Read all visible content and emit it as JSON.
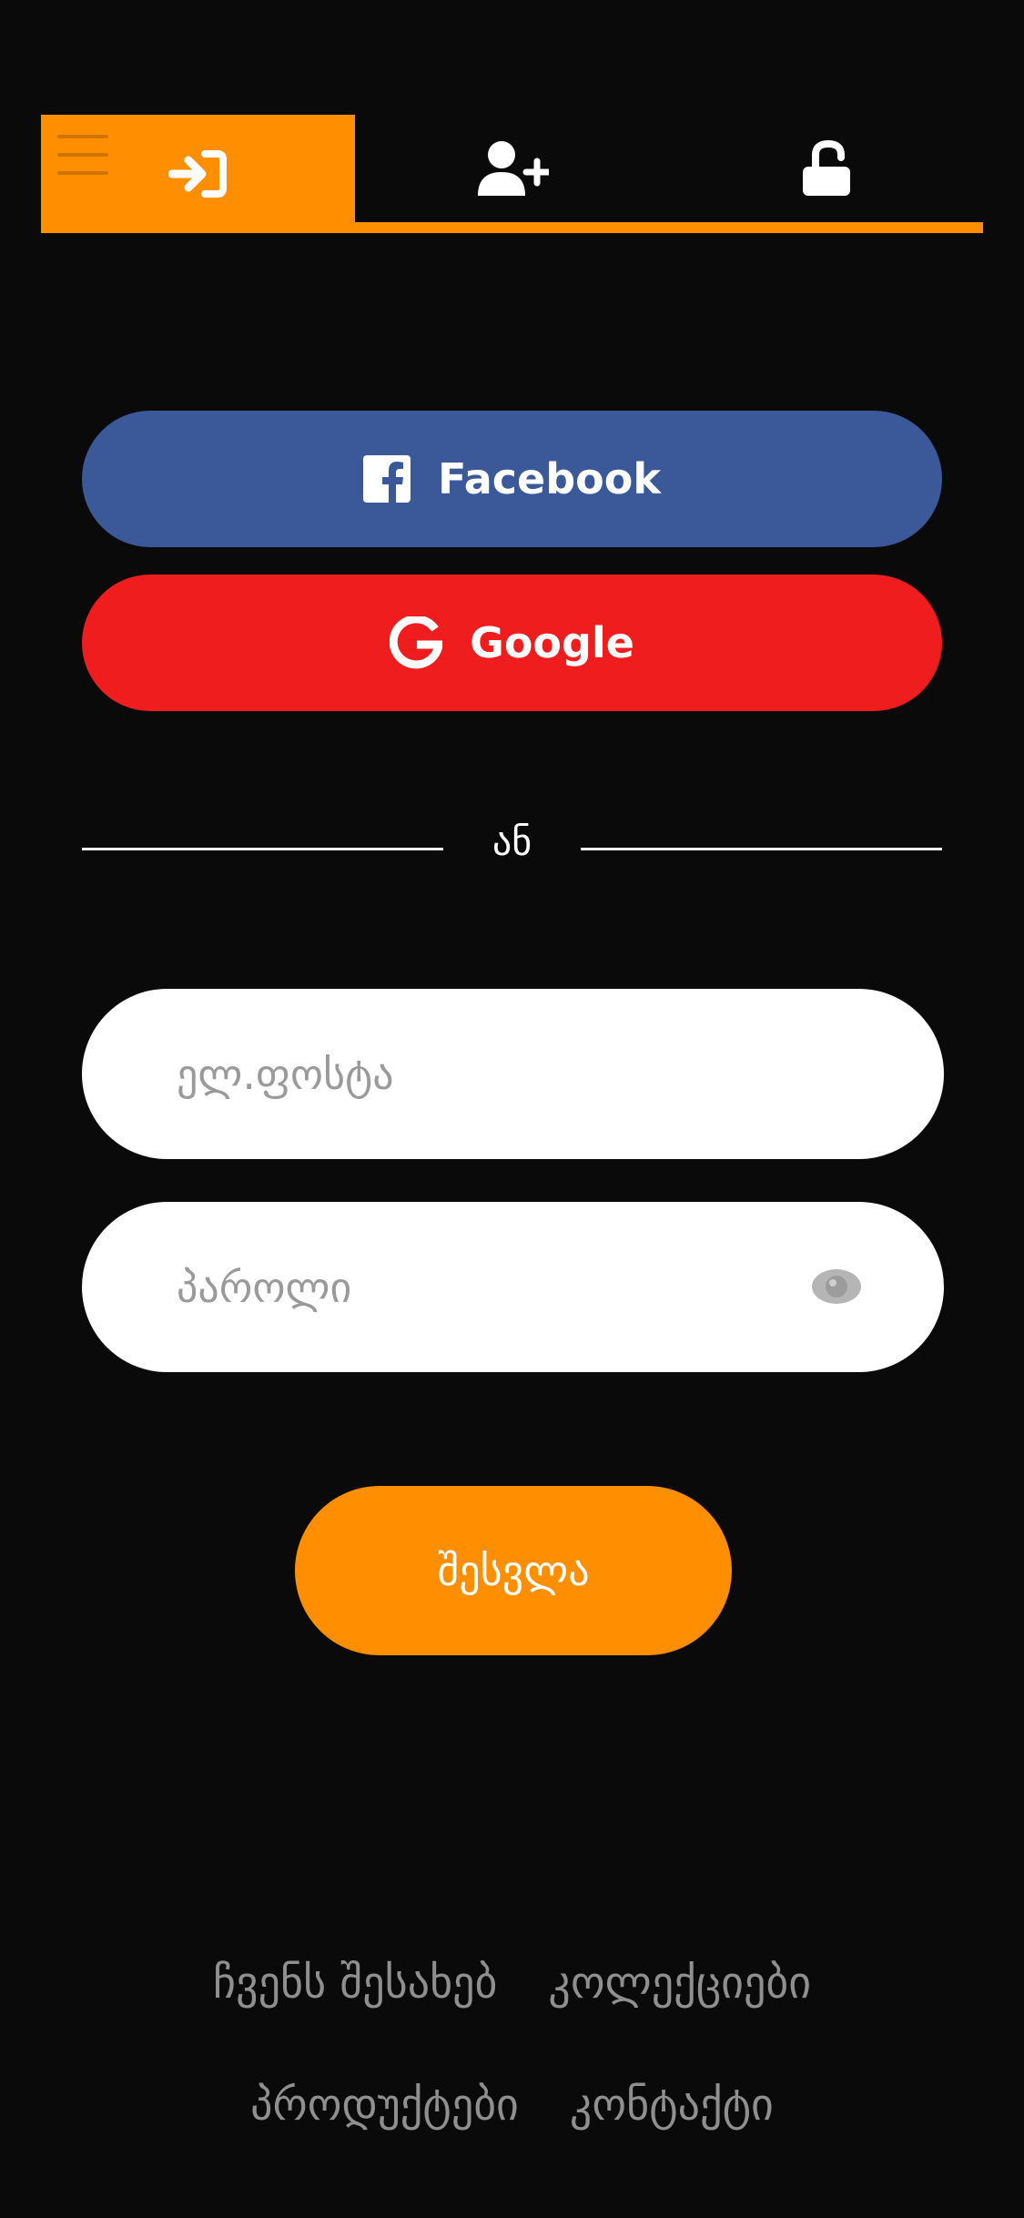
{
  "tabs": [
    {
      "id": "login",
      "icon": "sign-in-icon",
      "active": true
    },
    {
      "id": "register",
      "icon": "user-plus-icon",
      "active": false
    },
    {
      "id": "reset",
      "icon": "unlock-icon",
      "active": false
    }
  ],
  "menu": {
    "icon": "hamburger-menu-icon"
  },
  "social": {
    "facebook_label": "Facebook",
    "google_label": "Google"
  },
  "divider": {
    "text": "ან"
  },
  "form": {
    "email_placeholder": "ელ.ფოსტა",
    "password_placeholder": "პაროლი",
    "eye_icon": "eye-icon",
    "submit_label": "შესვლა"
  },
  "footer": {
    "links": [
      "ჩვენს შესახებ",
      "კოლექციები",
      "პროდუქტები",
      "კონტაქტი"
    ]
  },
  "colors": {
    "accent": "#ff8f00",
    "facebook": "#3b5998",
    "google": "#f01d1f",
    "background": "#0a0a0a"
  }
}
